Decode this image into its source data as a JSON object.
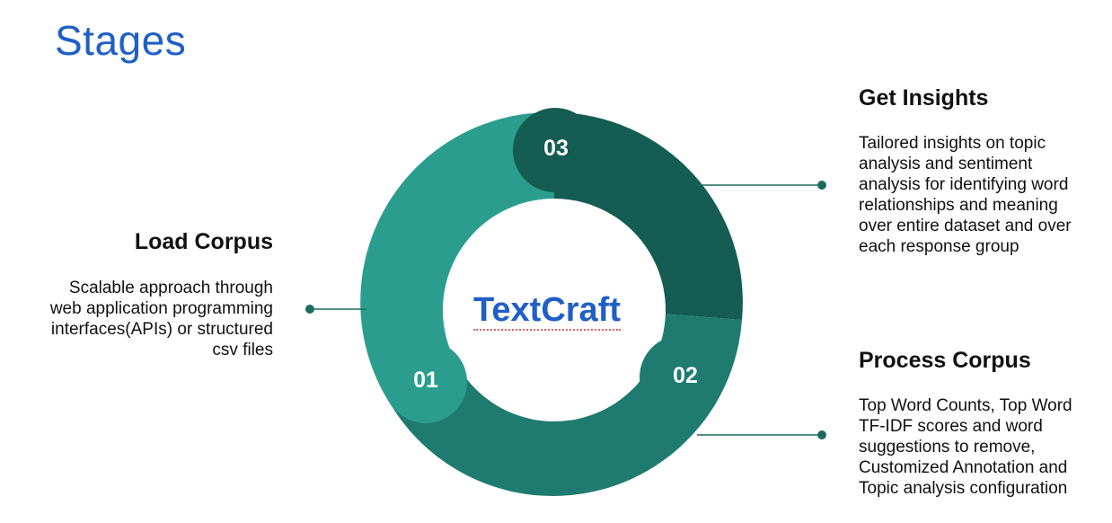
{
  "title": "Stages",
  "brand": "TextCraft",
  "colors": {
    "title": "#1f5fc7",
    "stage_01": "#2a9d8f",
    "stage_02": "#1f7b70",
    "stage_03": "#155c53",
    "connector": "#1d6b60"
  },
  "stages": [
    {
      "number": "01",
      "heading": "Load Corpus",
      "lines": [
        "Scalable approach through",
        "web application programming",
        "interfaces(APIs) or structured",
        "csv files"
      ]
    },
    {
      "number": "02",
      "heading": "Process Corpus",
      "lines": [
        "Top Word Counts, Top Word",
        "TF-IDF scores and word",
        "suggestions to remove,",
        "Customized Annotation and",
        "Topic analysis configuration"
      ]
    },
    {
      "number": "03",
      "heading": "Get Insights",
      "lines": [
        "Tailored insights on topic",
        "analysis and sentiment",
        "analysis for identifying word",
        "relationships and meaning",
        "over entire dataset and over",
        "each response group"
      ]
    }
  ]
}
